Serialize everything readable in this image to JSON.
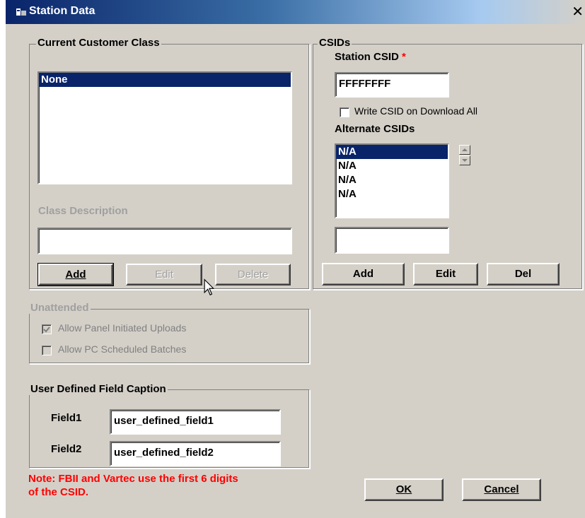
{
  "window": {
    "title": "Station Data",
    "close_label": "✕"
  },
  "customer_class": {
    "legend": "Current Customer Class",
    "items": [
      "None"
    ],
    "selected_index": 0,
    "description_label": "Class Description",
    "description_value": "",
    "add_label": "Add",
    "edit_label": "Edit",
    "delete_label": "Delete"
  },
  "csids": {
    "legend": "CSIDs",
    "station_csid_label": "Station CSID",
    "required_marker": "*",
    "station_csid_value": "FFFFFFFF",
    "write_csid_label": "Write CSID on Download All",
    "alternate_label": "Alternate CSIDs",
    "alternate_items": [
      "N/A",
      "N/A",
      "N/A",
      "N/A"
    ],
    "alternate_input_value": "",
    "add_label": "Add",
    "edit_label": "Edit",
    "del_label": "Del"
  },
  "unattended": {
    "legend": "Unattended",
    "allow_panel_label": "Allow Panel Initiated Uploads",
    "allow_panel_checked": true,
    "allow_pc_label": "Allow PC Scheduled Batches",
    "allow_pc_checked": false
  },
  "user_defined": {
    "legend": "User Defined Field Caption",
    "field1_label": "Field1",
    "field1_value": "user_defined_field1",
    "field2_label": "Field2",
    "field2_value": "user_defined_field2"
  },
  "note": {
    "line1": "Note: FBII and Vartec use the first 6 digits",
    "line2": "of the CSID.",
    "color": "#ff0000"
  },
  "footer": {
    "ok_label": "OK",
    "cancel_label": "Cancel"
  },
  "colors": {
    "selection": "#0a246a",
    "face": "#d4d0c8",
    "titlebar": "#0a246a"
  }
}
